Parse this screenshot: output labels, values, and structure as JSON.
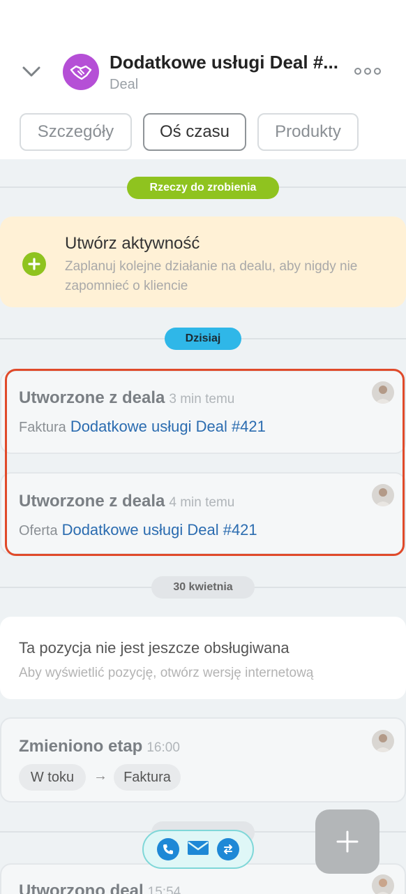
{
  "header": {
    "title": "Dodatkowe usługi Deal #...",
    "subtitle": "Deal"
  },
  "tabs": [
    "Szczegóły",
    "Oś czasu",
    "Produkty"
  ],
  "todo_label": "Rzeczy do zrobienia",
  "create_activity": {
    "title": "Utwórz aktywność",
    "desc": "Zaplanuj kolejne działanie na dealu, aby nigdy nie zapomnieć o kliencie"
  },
  "today_label": "Dzisiaj",
  "today_items": [
    {
      "title": "Utworzone z deala",
      "time": "3 min temu",
      "type": "Faktura",
      "link": "Dodatkowe usługi Deal #421"
    },
    {
      "title": "Utworzone z deala",
      "time": "4 min temu",
      "type": "Oferta",
      "link": "Dodatkowe usługi Deal #421"
    }
  ],
  "date_label": "30 kwietnia",
  "unsupported": {
    "title": "Ta pozycja nie jest jeszcze obsługiwana",
    "desc": "Aby wyświetlić pozycję, otwórz wersję internetową"
  },
  "stage_change": {
    "title": "Zmieniono etap",
    "time": "16:00",
    "from": "W toku",
    "to": "Faktura"
  },
  "created_deal": {
    "title": "Utworzono deal",
    "time": "15:54"
  },
  "colors": {
    "accent_green": "#8fc31f",
    "accent_blue": "#2fb7e8",
    "highlight": "#e04a2a",
    "deal_icon": "#b54fd6"
  }
}
